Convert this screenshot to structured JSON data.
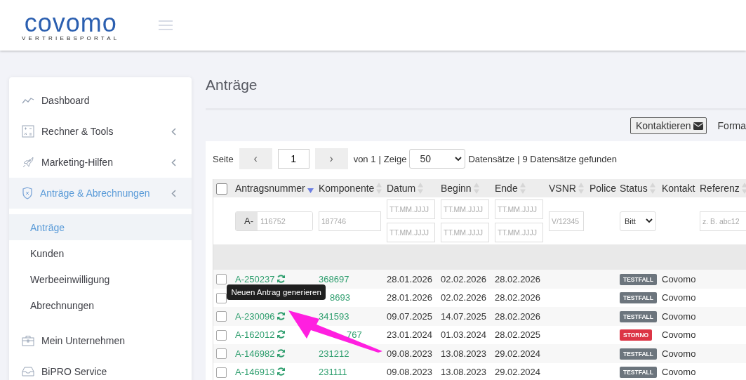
{
  "header": {
    "logo": "covomo",
    "tagline": "VERTRIEBSPORTAL"
  },
  "sidebar": {
    "items": [
      {
        "label": "Dashboard",
        "selected": false,
        "expandable": false
      },
      {
        "label": "Rechner & Tools",
        "selected": false,
        "expandable": true
      },
      {
        "label": "Marketing-Hilfen",
        "selected": false,
        "expandable": true
      },
      {
        "label": "Anträge & Abrechnungen",
        "selected": true,
        "expandable": true,
        "children": [
          {
            "label": "Anträge",
            "selected": true
          },
          {
            "label": "Kunden",
            "selected": false
          },
          {
            "label": "Werbeeinwilligung",
            "selected": false
          },
          {
            "label": "Abrechnungen",
            "selected": false
          }
        ]
      },
      {
        "label": "Mein Unternehmen",
        "selected": false,
        "expandable": false
      },
      {
        "label": "BiPRO Service",
        "selected": false,
        "expandable": false
      }
    ]
  },
  "page_title": "Anträge",
  "toolbar": {
    "contact_button": "Kontaktieren",
    "format_label": "Forma"
  },
  "pagination": {
    "page_label": "Seite",
    "prev": "‹",
    "page": "1",
    "next": "›",
    "of": "von 1",
    "sep1": "|",
    "show": "Zeige",
    "page_size": "50",
    "records": "Datensätze",
    "sep2": "|",
    "found": "9 Datensätze gefunden"
  },
  "table": {
    "select_all_checked": false,
    "columns": [
      {
        "label": "Antragsnummer",
        "sorted": true,
        "filter": {
          "kind": "prefixed",
          "prefix": "A-",
          "placeholder": "116752"
        }
      },
      {
        "label": "Komponente",
        "sorted": false,
        "filter": {
          "kind": "text",
          "placeholder": "187746"
        }
      },
      {
        "label": "Datum",
        "sorted": false,
        "filter": {
          "kind": "daterange",
          "placeholders": [
            "TT.MM.JJJJ",
            "TT.MM.JJJJ"
          ]
        }
      },
      {
        "label": "Beginn",
        "sorted": false,
        "filter": {
          "kind": "daterange",
          "placeholders": [
            "TT.MM.JJJJ",
            "TT.MM.JJJJ"
          ]
        }
      },
      {
        "label": "Ende",
        "sorted": false,
        "filter": {
          "kind": "daterange",
          "placeholders": [
            "TT.MM.JJJJ",
            "TT.MM.JJJJ"
          ]
        }
      },
      {
        "label": "VSNR",
        "sorted": false,
        "filter": {
          "kind": "text",
          "placeholder": "V/12345"
        }
      },
      {
        "label": "Police",
        "filter": {
          "kind": "none"
        }
      },
      {
        "label": "Status",
        "sorted": false,
        "filter": {
          "kind": "select",
          "value": "Bitt"
        }
      },
      {
        "label": "Kontakt",
        "filter": {
          "kind": "none"
        }
      },
      {
        "label": "Referenz",
        "sorted": false,
        "filter": {
          "kind": "text",
          "placeholder": "z. B. abc12"
        }
      }
    ],
    "rows": [
      {
        "checked": false,
        "number": "A-250237",
        "component": "368697",
        "date": "28.01.2026",
        "start": "02.02.2026",
        "end": "28.02.2026",
        "status": {
          "label": "TESTFALL",
          "kind": "test"
        },
        "contact": "Covomo"
      },
      {
        "checked": false,
        "component": "8693",
        "component_hidden": true,
        "date": "28.01.2026",
        "start": "02.02.2026",
        "end": "28.02.2026",
        "status": {
          "label": "TESTFALL",
          "kind": "test"
        },
        "contact": "Covomo"
      },
      {
        "checked": false,
        "number": "A-230096",
        "component": "341593",
        "date": "09.07.2025",
        "start": "14.07.2025",
        "end": "28.02.2026",
        "status": {
          "label": "TESTFALL",
          "kind": "test"
        },
        "contact": "Covomo",
        "tooltip": "Neuen Antrag generieren"
      },
      {
        "checked": false,
        "number": "A-162012",
        "component": "767",
        "component_hidden": true,
        "date": "23.01.2024",
        "start": "01.03.2024",
        "end": "28.02.2025",
        "status": {
          "label": "STORNO",
          "kind": "storno"
        },
        "contact": "Covomo"
      },
      {
        "checked": false,
        "number": "A-146982",
        "component": "231212",
        "date": "09.08.2023",
        "start": "13.08.2023",
        "end": "29.02.2024",
        "status": {
          "label": "TESTFALL",
          "kind": "test"
        },
        "contact": "Covomo"
      },
      {
        "checked": false,
        "number": "A-146913",
        "component": "231111",
        "date": "09.08.2023",
        "start": "13.08.2023",
        "end": "29.02.2024",
        "status": {
          "label": "TESTFALL",
          "kind": "test"
        },
        "contact": "Covomo"
      }
    ]
  }
}
